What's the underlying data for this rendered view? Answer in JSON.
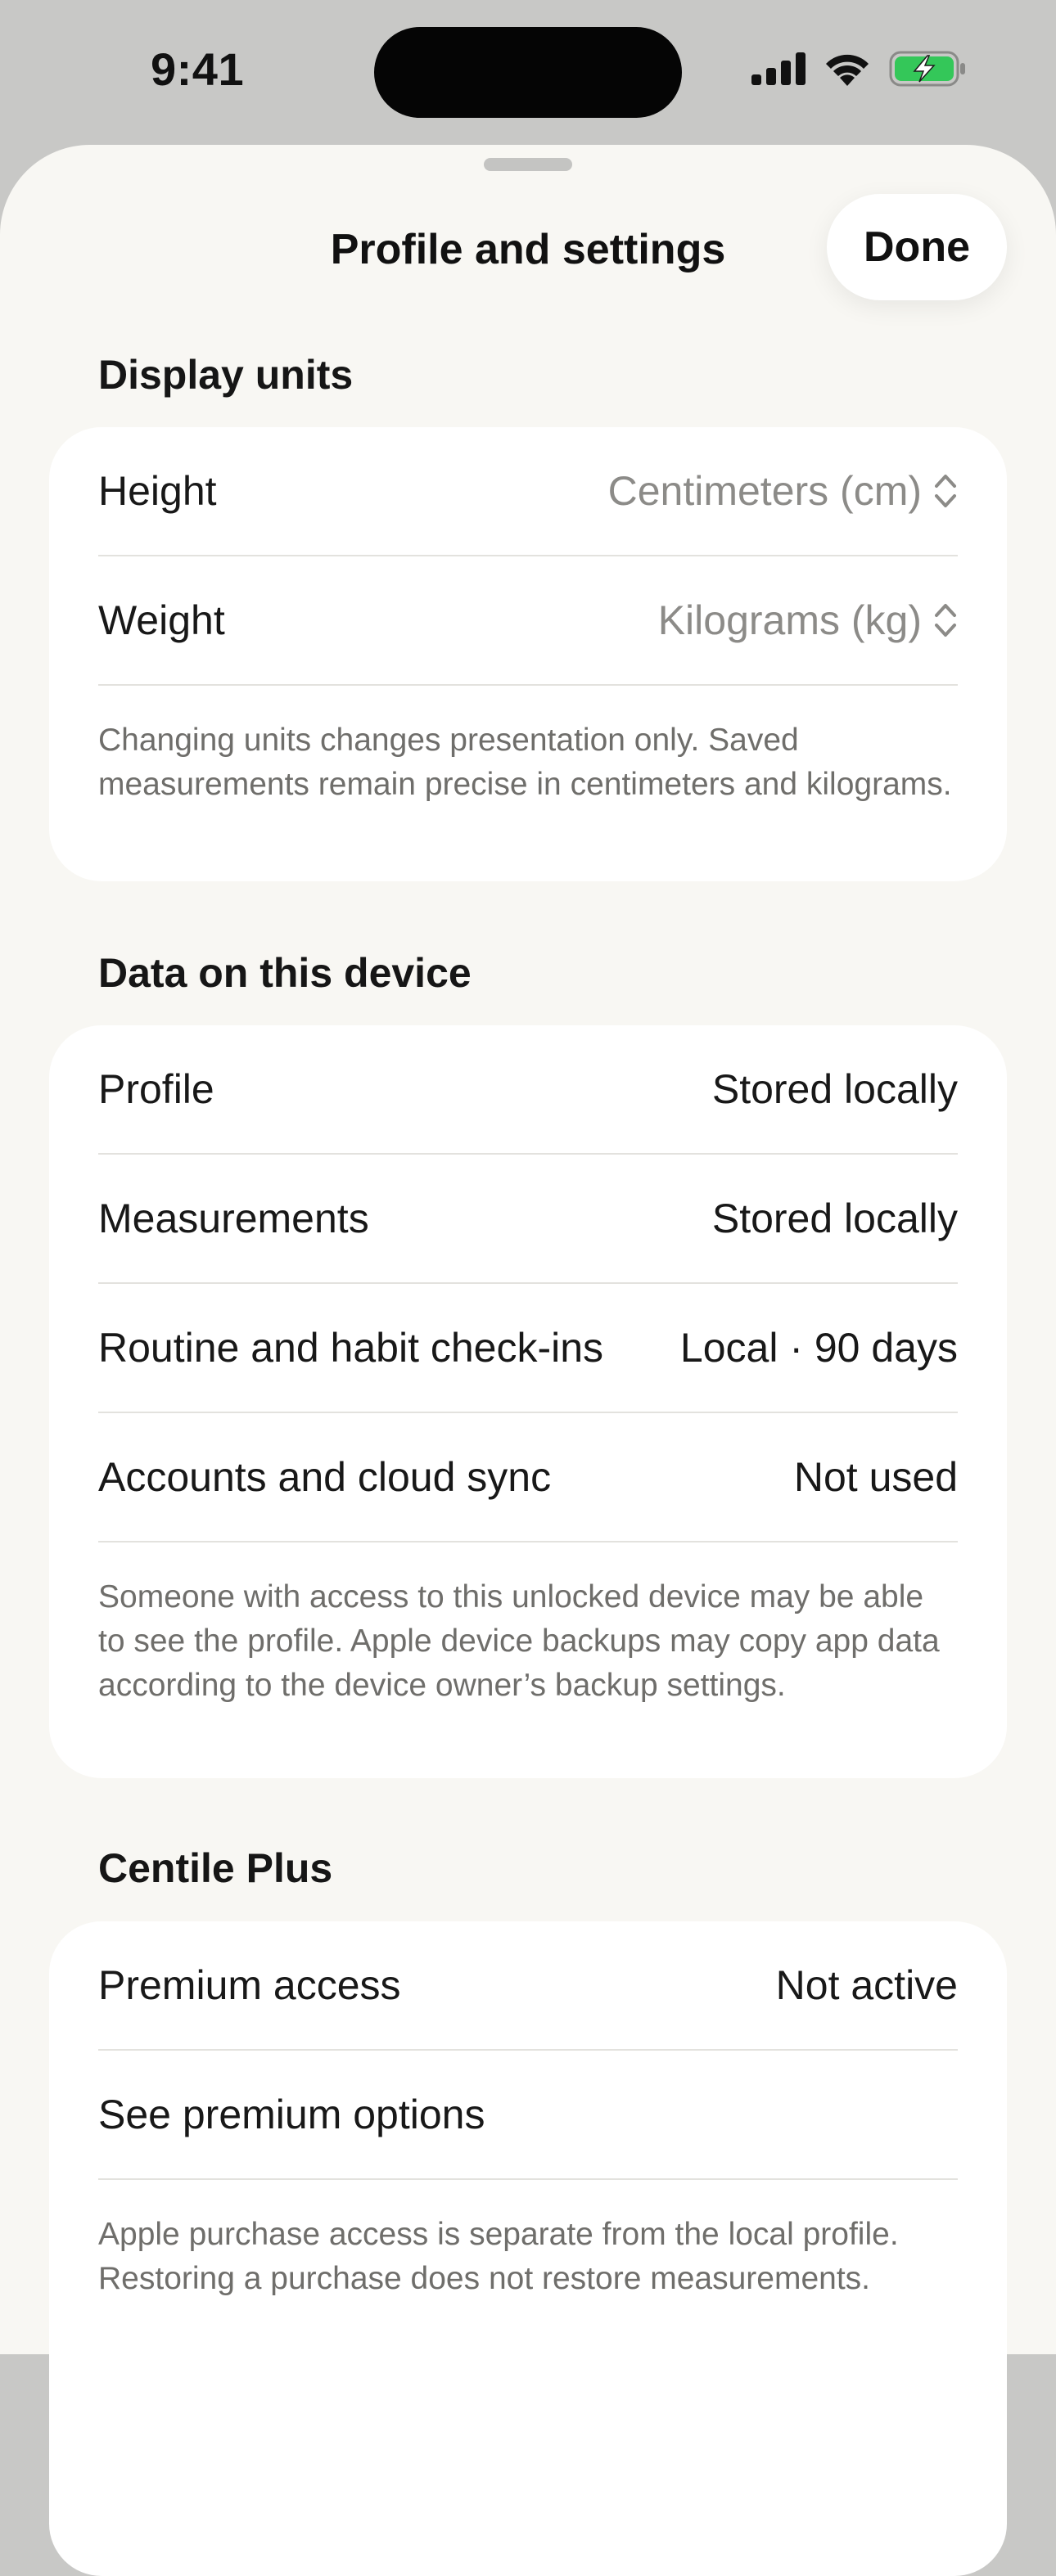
{
  "status_bar": {
    "time": "9:41",
    "signal_icon": "cellular-signal-icon",
    "wifi_icon": "wifi-icon",
    "battery_icon": "battery-charging-icon",
    "battery_color": "#34c759"
  },
  "sheet": {
    "title": "Profile and settings",
    "done_label": "Done"
  },
  "display_units": {
    "header": "Display units",
    "rows": [
      {
        "label": "Height",
        "value": "Centimeters (cm)"
      },
      {
        "label": "Weight",
        "value": "Kilograms (kg)"
      }
    ],
    "footnote": "Changing units changes presentation only. Saved measurements remain precise in centimeters and kilograms."
  },
  "data_on_device": {
    "header": "Data on this device",
    "rows": [
      {
        "label": "Profile",
        "value": "Stored locally"
      },
      {
        "label": "Measurements",
        "value": "Stored locally"
      },
      {
        "label": "Routine and habit check-ins",
        "value": "Local · 90 days"
      },
      {
        "label": "Accounts and cloud sync",
        "value": "Not used"
      }
    ],
    "footnote": "Someone with access to this unlocked device may be able to see the profile. Apple device backups may copy app data according to the device owner’s backup settings."
  },
  "centile_plus": {
    "header": "Centile Plus",
    "rows": [
      {
        "label": "Premium access",
        "value": "Not active"
      },
      {
        "label": "See premium options",
        "value": ""
      }
    ],
    "footnote": "Apple purchase access is separate from the local profile. Restoring a purchase does not restore measurements."
  }
}
